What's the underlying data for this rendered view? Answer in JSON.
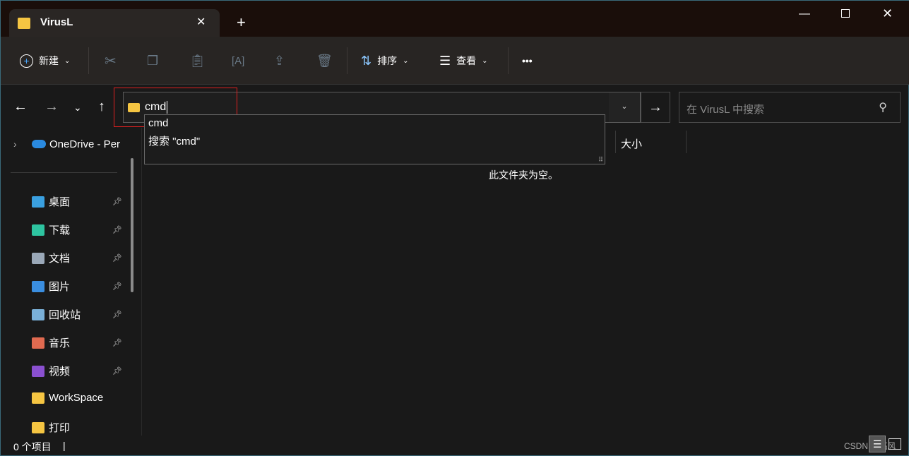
{
  "window": {
    "tab_title": "VirusL",
    "controls": [
      "minimize",
      "maximize",
      "close"
    ]
  },
  "toolbar": {
    "new": "新建",
    "sort": "排序",
    "view": "查看",
    "more": "•••"
  },
  "address": {
    "value": "cmd",
    "suggestions": [
      "cmd",
      "搜索 \"cmd\""
    ]
  },
  "search": {
    "placeholder": "在 VirusL 中搜索"
  },
  "columns": {
    "size": "大小"
  },
  "content": {
    "empty": "此文件夹为空。"
  },
  "sidebar": {
    "onedrive": "OneDrive - Per",
    "items": [
      {
        "label": "桌面",
        "icon": "desktop-icon",
        "color": "#3aa0e0",
        "pinned": true
      },
      {
        "label": "下载",
        "icon": "download-icon",
        "color": "#2ec4a0",
        "pinned": true
      },
      {
        "label": "文档",
        "icon": "document-icon",
        "color": "#9aa8b8",
        "pinned": true
      },
      {
        "label": "图片",
        "icon": "pictures-icon",
        "color": "#3a8ee0",
        "pinned": true
      },
      {
        "label": "回收站",
        "icon": "recycle-bin-icon",
        "color": "#7ab0d8",
        "pinned": true
      },
      {
        "label": "音乐",
        "icon": "music-icon",
        "color": "#e06a50",
        "pinned": true
      },
      {
        "label": "视频",
        "icon": "video-icon",
        "color": "#8a50d0",
        "pinned": true
      },
      {
        "label": "WorkSpace",
        "icon": "folder-icon",
        "color": "#f5c542",
        "pinned": false
      },
      {
        "label": "打印",
        "icon": "folder-icon",
        "color": "#f5c542",
        "pinned": false
      }
    ]
  },
  "status": {
    "count": "0 个项目"
  },
  "watermark": "CSDN @临风"
}
